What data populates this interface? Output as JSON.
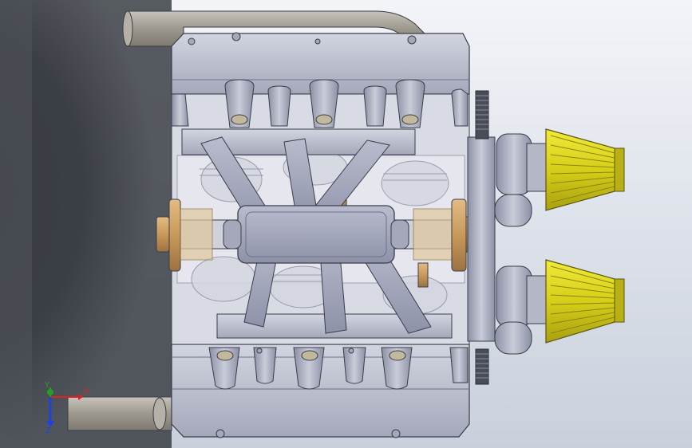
{
  "viewport": {
    "background_top": "#f2f4f8",
    "background_bottom": "#c9d0dc",
    "shadow_color": "#2f3338"
  },
  "model": {
    "palette": {
      "metal_light": "#c8cbd8",
      "metal_mid": "#9fa3b6",
      "metal_dark": "#6e7286",
      "intake_tube": "#a7a298",
      "bearing_bronze": "#c89a5c",
      "filter_yellow": "#d8d41c",
      "outline": "#3a3d48"
    }
  },
  "triad": {
    "x_label": "X",
    "y_label": "Y",
    "z_label": "Z",
    "x_color": "#e02020",
    "y_color": "#22a022",
    "z_color": "#2040e0"
  }
}
